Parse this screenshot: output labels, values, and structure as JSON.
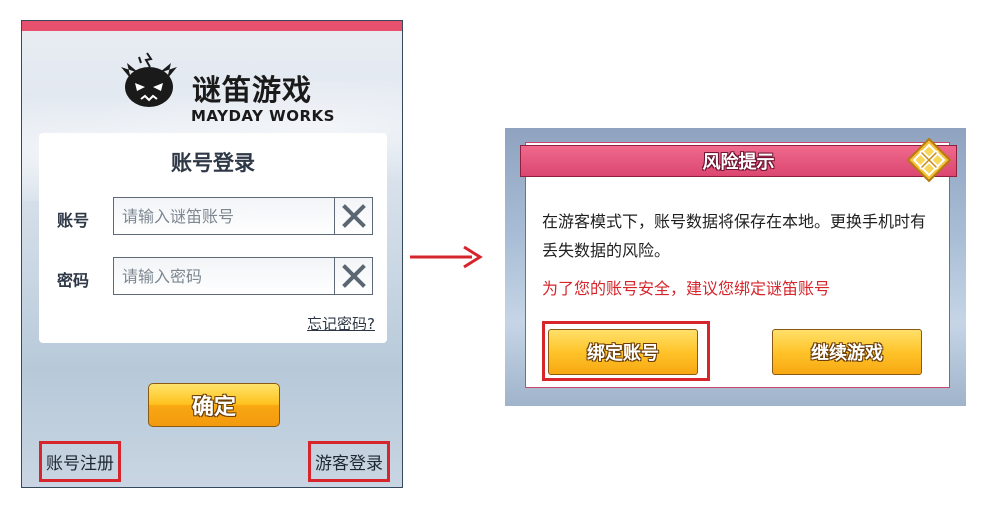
{
  "login": {
    "logo_cn": "谜笛游戏",
    "logo_en": "MAYDAY WORKS",
    "title": "账号登录",
    "account_label": "账号",
    "account_placeholder": "请输入谜笛账号",
    "password_label": "密码",
    "password_placeholder": "请输入密码",
    "forgot_password": "忘记密码?",
    "confirm": "确定",
    "register": "账号注册",
    "guest_login": "游客登录"
  },
  "dialog": {
    "title": "风险提示",
    "message": "在游客模式下，账号数据将保存在本地。更换手机时有丢失数据的风险。",
    "warning": "为了您的账号安全，建议您绑定谜笛账号",
    "bind_button": "绑定账号",
    "continue_button": "继续游戏"
  },
  "colors": {
    "accent_pink": "#e8516e",
    "button_gold": "#ffc21f",
    "highlight_red": "#d6262c",
    "warning_red": "#d6262c"
  },
  "icons": [
    "mascot-logo-icon",
    "clear-x-icon",
    "arrow-right-icon",
    "close-diamond-icon"
  ]
}
